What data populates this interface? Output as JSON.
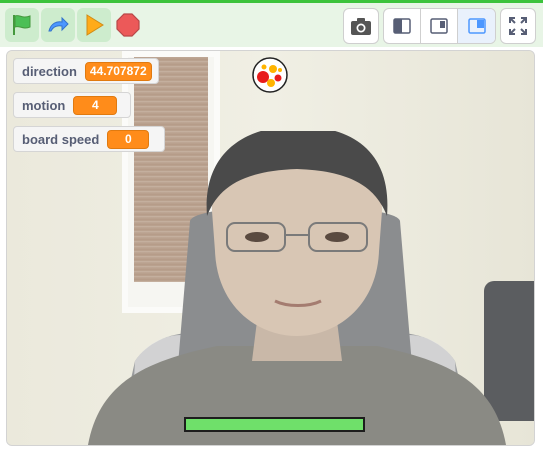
{
  "toolbar": {
    "green_flag": {
      "icon": "green-flag-icon",
      "color": "#4cbf56"
    },
    "turbo": {
      "icon": "turbo-arrow-icon",
      "color": "#4c97ff"
    },
    "run": {
      "icon": "play-icon",
      "color": "#ffab19"
    },
    "stop": {
      "icon": "stop-sign-icon",
      "color": "#ec5959"
    },
    "right_buttons": [
      "camera-icon",
      "small-stage-icon",
      "normal-stage-icon",
      "large-stage-icon",
      "fullscreen-icon"
    ]
  },
  "monitors": [
    {
      "label": "direction",
      "value": "44.707872"
    },
    {
      "label": "motion",
      "value": "4"
    },
    {
      "label": "board speed",
      "value": "0"
    }
  ],
  "colors": {
    "accent": "#ff8c1a",
    "paddle": "#6fe06a",
    "toolbar_bg": "#e8f5e6"
  }
}
